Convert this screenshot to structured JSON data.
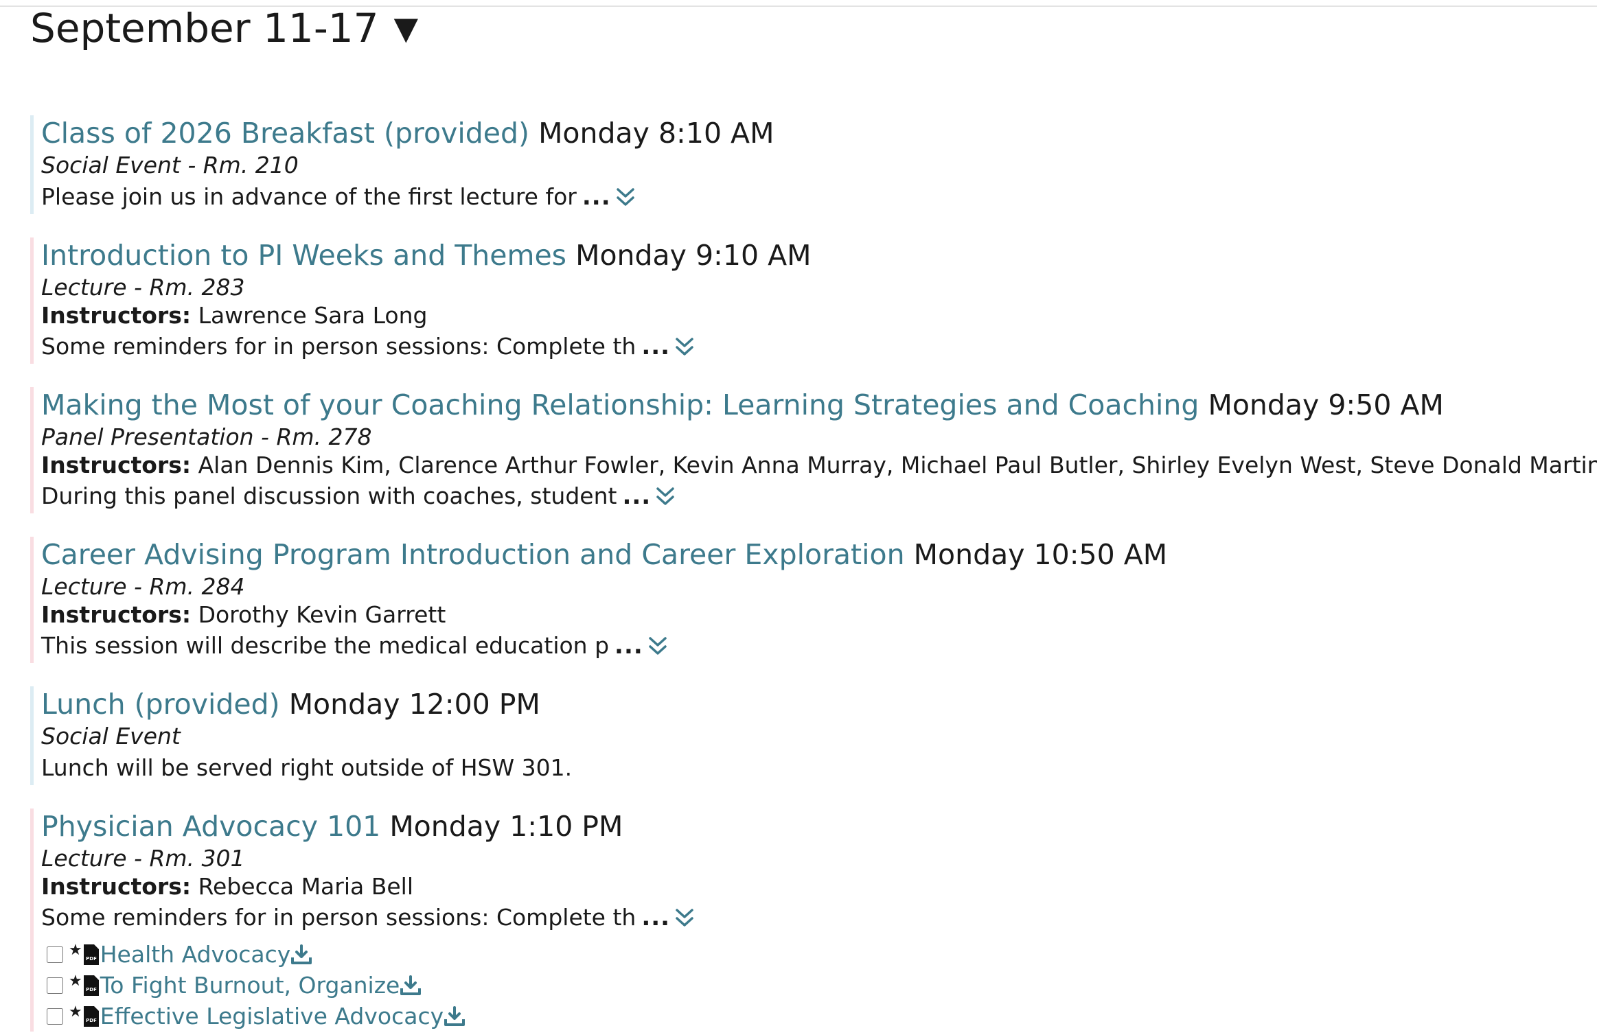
{
  "week": {
    "label": "September 11-17",
    "caret": "▼"
  },
  "colors": {
    "link": "#3d7a8c",
    "social_border": "#dcecf3",
    "lecture_border": "#f9dde2"
  },
  "events": [
    {
      "title": "Class of 2026 Breakfast (provided)",
      "time": "Monday 8:10 AM",
      "meta": "Social Event - Rm. 210",
      "description": "Please join us in advance of the first lecture for",
      "ellipsis": "...",
      "expand_icon": "double-chevron-down-icon"
    },
    {
      "title": "Introduction to PI Weeks and Themes",
      "time": "Monday 9:10 AM",
      "meta": "Lecture - Rm. 283",
      "instructors_label": "Instructors:",
      "instructors": "Lawrence Sara Long",
      "description": "Some reminders for in person sessions: Complete th",
      "ellipsis": "...",
      "expand_icon": "double-chevron-down-icon"
    },
    {
      "title": "Making the Most of your Coaching Relationship: Learning Strategies and Coaching",
      "time": "Monday 9:50 AM",
      "meta": "Panel Presentation - Rm. 278",
      "instructors_label": "Instructors:",
      "instructors": "Alan Dennis Kim, Clarence Arthur Fowler, Kevin Anna Murray, Michael Paul Butler, Shirley Evelyn West, Steve Donald Martinez",
      "description": "During this panel discussion with coaches, student",
      "ellipsis": "...",
      "expand_icon": "double-chevron-down-icon"
    },
    {
      "title": "Career Advising Program Introduction and Career Exploration",
      "time": "Monday 10:50 AM",
      "meta": "Lecture - Rm. 284",
      "instructors_label": "Instructors:",
      "instructors": "Dorothy Kevin Garrett",
      "description": "This session will describe the medical education p",
      "ellipsis": "...",
      "expand_icon": "double-chevron-down-icon"
    },
    {
      "title": "Lunch (provided)",
      "time": "Monday 12:00 PM",
      "meta": "Social Event",
      "description": "Lunch will be served right outside of HSW 301."
    },
    {
      "title": "Physician Advocacy 101",
      "time": "Monday 1:10 PM",
      "meta": "Lecture - Rm. 301",
      "instructors_label": "Instructors:",
      "instructors": "Rebecca Maria Bell",
      "description": "Some reminders for in person sessions: Complete th",
      "ellipsis": "...",
      "expand_icon": "double-chevron-down-icon",
      "attachments": [
        {
          "name": "Health Advocacy",
          "star": "★",
          "file_icon": "pdf-icon",
          "download_icon": "download-icon"
        },
        {
          "name": "To Fight Burnout, Organize",
          "star": "★",
          "file_icon": "pdf-icon",
          "download_icon": "download-icon"
        },
        {
          "name": "Effective Legislative Advocacy",
          "star": "★",
          "file_icon": "pdf-icon",
          "download_icon": "download-icon"
        }
      ]
    }
  ]
}
